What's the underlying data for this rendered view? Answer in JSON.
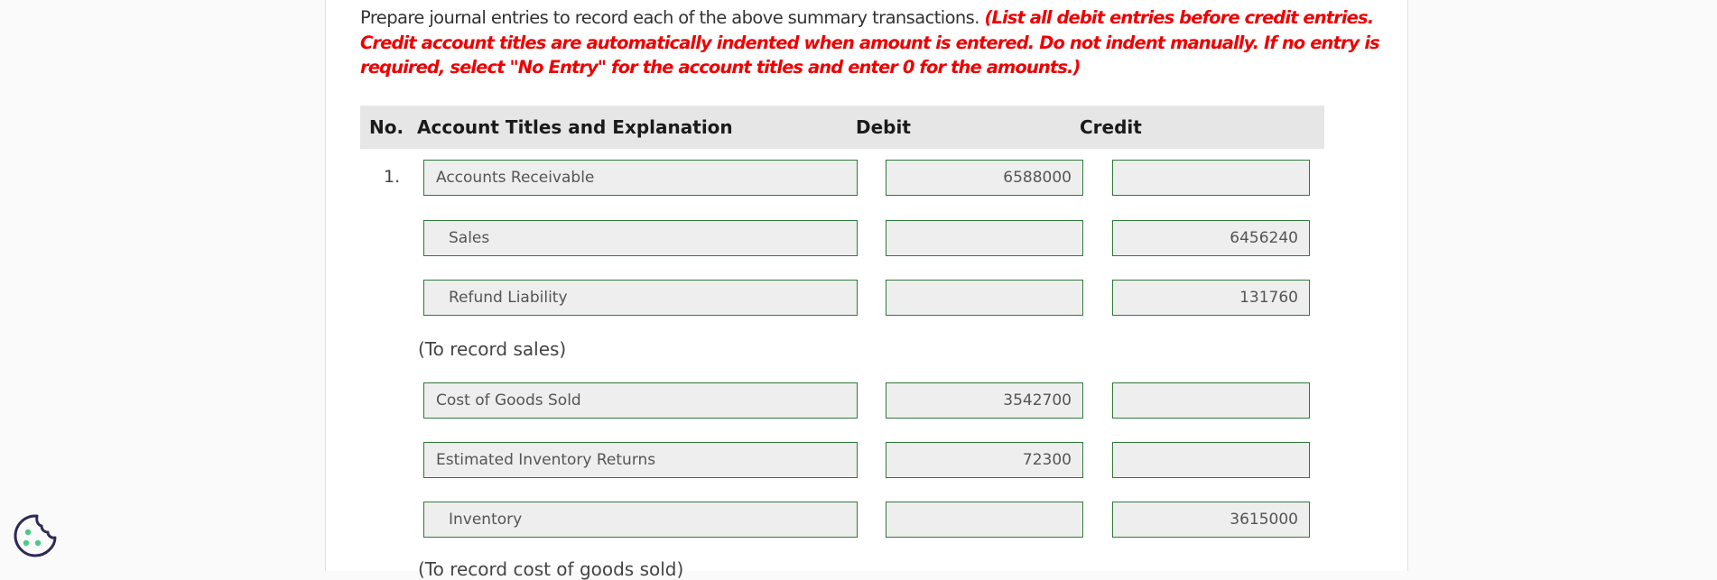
{
  "instructions": {
    "text": "Prepare journal entries to record each of the above summary transactions.",
    "note": "(List all debit entries before credit entries. Credit account titles are automatically indented when amount is entered. Do not indent manually. If no entry is required, select \"No Entry\" for the account titles and enter 0 for the amounts.)"
  },
  "table": {
    "headers": {
      "no": "No.",
      "account": "Account Titles and Explanation",
      "debit": "Debit",
      "credit": "Credit"
    },
    "entry_number": "1.",
    "rows": [
      {
        "account": "Accounts Receivable",
        "debit": "6588000",
        "credit": ""
      },
      {
        "account": "Sales",
        "debit": "",
        "credit": "6456240"
      },
      {
        "account": "Refund Liability",
        "debit": "",
        "credit": "131760"
      },
      {
        "account": "Cost of Goods Sold",
        "debit": "3542700",
        "credit": ""
      },
      {
        "account": "Estimated Inventory Returns",
        "debit": "72300",
        "credit": ""
      },
      {
        "account": "Inventory",
        "debit": "",
        "credit": "3615000"
      }
    ],
    "memos": [
      "(To record sales)",
      "(To record cost of goods sold)"
    ]
  },
  "colors": {
    "note_red": "#ee0000",
    "field_border": "#2f7a3b",
    "header_bg": "#e6e6e6",
    "cookie_icon": "#2d2a5a",
    "cookie_dots": "#4cc98a"
  },
  "icons": {
    "cookie": "cookie-settings-icon"
  }
}
